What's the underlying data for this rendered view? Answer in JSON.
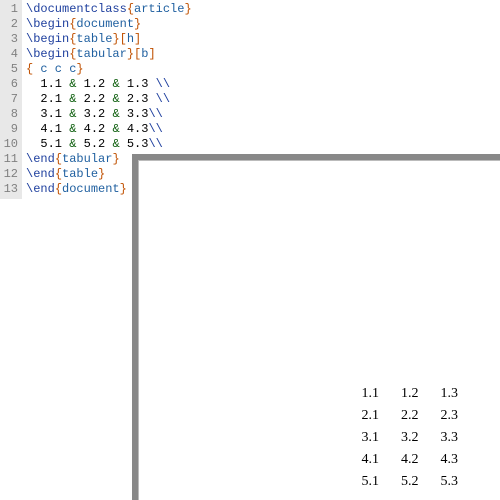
{
  "editor": {
    "lineNumbers": [
      "1",
      "2",
      "3",
      "4",
      "5",
      "6",
      "7",
      "8",
      "9",
      "10",
      "11",
      "12",
      "13"
    ],
    "lines": [
      {
        "cmd": "\\documentclass",
        "arg": "article"
      },
      {
        "cmd": "\\begin",
        "arg": "document"
      },
      {
        "cmd": "\\begin",
        "arg": "table",
        "opt": "h"
      },
      {
        "cmd": "\\begin",
        "arg": "tabular",
        "opt": "b"
      },
      {
        "columnSpec": " c c c"
      },
      {
        "indent": "  ",
        "cells": [
          "1.1",
          "1.2",
          "1.3"
        ],
        "trail": " "
      },
      {
        "indent": "  ",
        "cells": [
          "2.1",
          "2.2",
          "2.3"
        ],
        "trail": " "
      },
      {
        "indent": "  ",
        "cells": [
          "3.1",
          "3.2",
          "3.3"
        ],
        "trail": ""
      },
      {
        "indent": "  ",
        "cells": [
          "4.1",
          "4.2",
          "4.3"
        ],
        "trail": ""
      },
      {
        "indent": "  ",
        "cells": [
          "5.1",
          "5.2",
          "5.3"
        ],
        "trail": ""
      },
      {
        "cmd": "\\end",
        "arg": "tabular"
      },
      {
        "cmd": "\\end",
        "arg": "table"
      },
      {
        "cmd": "\\end",
        "arg": "document"
      }
    ]
  },
  "output": {
    "rows": [
      [
        "1.1",
        "1.2",
        "1.3"
      ],
      [
        "2.1",
        "2.2",
        "2.3"
      ],
      [
        "3.1",
        "3.2",
        "3.3"
      ],
      [
        "4.1",
        "4.2",
        "4.3"
      ],
      [
        "5.1",
        "5.2",
        "5.3"
      ]
    ]
  }
}
